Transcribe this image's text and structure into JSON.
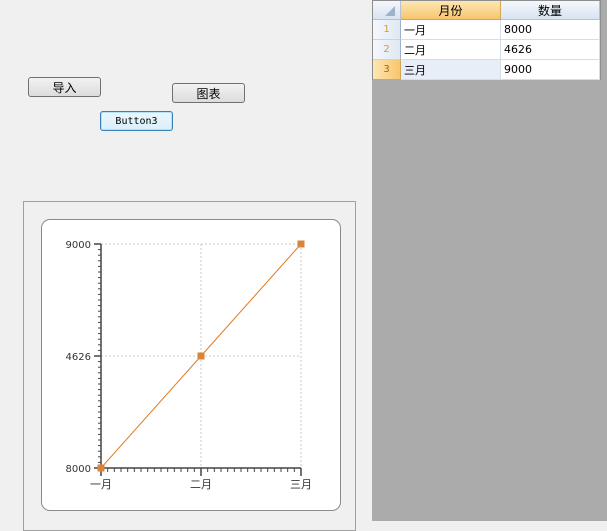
{
  "buttons": {
    "import_label": "导入",
    "chart_label": "图表",
    "button3_label": "Button3"
  },
  "grid": {
    "columns": [
      "月份",
      "数量"
    ],
    "rows": [
      {
        "num": "1",
        "month": "一月",
        "qty": "8000"
      },
      {
        "num": "2",
        "month": "二月",
        "qty": "4626"
      },
      {
        "num": "3",
        "month": "三月",
        "qty": "9000"
      }
    ]
  },
  "colors": {
    "series": "#e07a1f",
    "marker": "#d9843a",
    "gridline": "#c8c8c8"
  },
  "chart_data": {
    "type": "line",
    "categories": [
      "一月",
      "二月",
      "三月"
    ],
    "series": [
      {
        "values": [
          8000,
          4626,
          9000
        ]
      }
    ],
    "y_ticks": [
      "9000",
      "4626",
      "8000"
    ],
    "grid": true
  }
}
